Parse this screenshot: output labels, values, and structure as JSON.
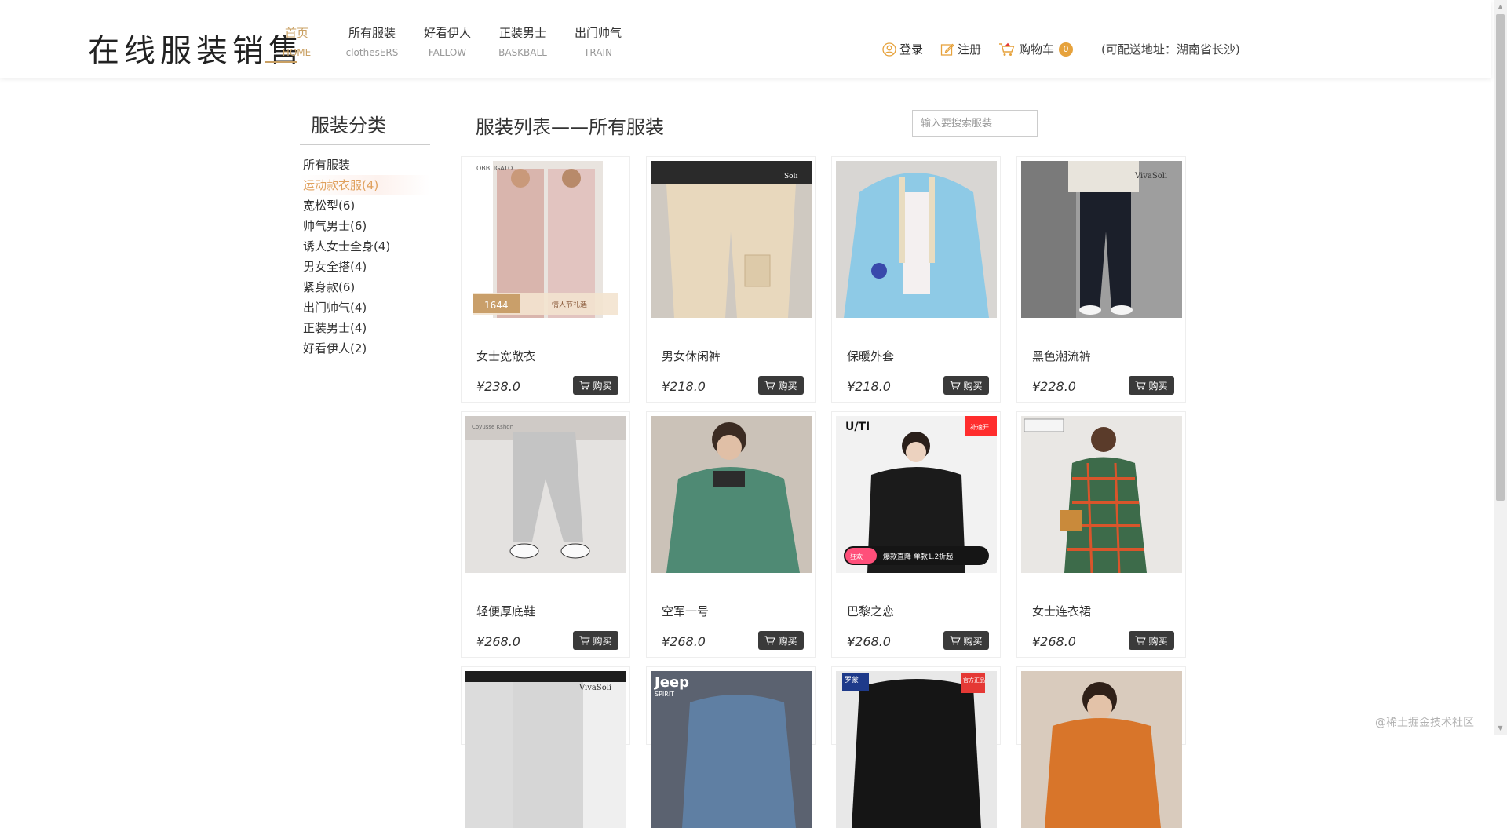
{
  "header": {
    "logo": "在线服装销售",
    "nav": [
      {
        "cn": "首页",
        "en": "HOME"
      },
      {
        "cn": "所有服装",
        "en": "clothesERS"
      },
      {
        "cn": "好看伊人",
        "en": "FALLOW"
      },
      {
        "cn": "正装男士",
        "en": "BASKBALL"
      },
      {
        "cn": "出门帅气",
        "en": "TRAIN"
      }
    ],
    "login": "登录",
    "register": "注册",
    "cart": "购物车",
    "cart_count": "0",
    "ship_address": "(可配送地址：湖南省长沙)"
  },
  "sidebar": {
    "title": "服装分类",
    "items": [
      "所有服装",
      "运动款衣服(4)",
      "宽松型(6)",
      "帅气男士(6)",
      "诱人女士全身(4)",
      "男女全搭(4)",
      "紧身款(6)",
      "出门帅气(4)",
      "正装男士(4)",
      "好看伊人(2)"
    ]
  },
  "main": {
    "title": "服装列表——所有服装",
    "search_placeholder": "输入要搜索服装",
    "buy_label": "购买",
    "products": [
      {
        "name": "女士宽敞衣",
        "price": "¥238.0"
      },
      {
        "name": "男女休闲裤",
        "price": "¥218.0"
      },
      {
        "name": "保暖外套",
        "price": "¥218.0"
      },
      {
        "name": "黑色潮流裤",
        "price": "¥228.0"
      },
      {
        "name": "轻便厚底鞋",
        "price": "¥268.0"
      },
      {
        "name": "空军一号",
        "price": "¥268.0"
      },
      {
        "name": "巴黎之恋",
        "price": "¥268.0"
      },
      {
        "name": "女士连衣裙",
        "price": "¥268.0"
      }
    ],
    "image_text": {
      "p1_brand": "OBBLIGATO",
      "p1_price": "1644",
      "p1_promo": "情人节礼遇",
      "p2_brand": "Soli",
      "p4_brand": "VivaSoli",
      "p5_brand": "Coyusse Kshdn",
      "p7_brand": "U/TI",
      "p7_badge": "补速开",
      "p7_tag": "狂欢",
      "p7_promo": "爆款直降 单款1.2折起",
      "p9_brand": "VivaSoli",
      "p10_brand": "Jeep",
      "p10_sub": "SPIRIT",
      "p11_brand": "罗蒙",
      "p11_badge": "官方正品"
    }
  },
  "watermark": "@稀土掘金技术社区",
  "colors": {
    "accent": "#c9a063",
    "active_category": "#e0a15e",
    "buy_button": "#3a3a3a",
    "badge": "#e6a23c"
  }
}
